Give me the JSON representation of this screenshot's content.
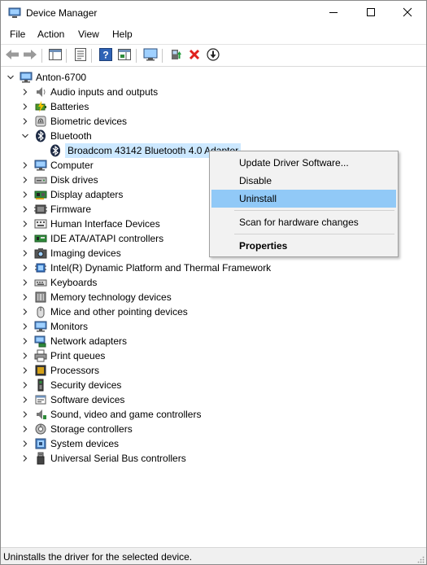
{
  "window": {
    "title": "Device Manager"
  },
  "menu": [
    "File",
    "Action",
    "View",
    "Help"
  ],
  "tree": {
    "root": "Anton-6700",
    "categories": [
      {
        "label": "Audio inputs and outputs",
        "icon": "speaker-icon"
      },
      {
        "label": "Batteries",
        "icon": "battery-icon"
      },
      {
        "label": "Biometric devices",
        "icon": "fingerprint-icon"
      },
      {
        "label": "Bluetooth",
        "icon": "bluetooth-icon",
        "expanded": true
      },
      {
        "label": "Computer",
        "icon": "computer-icon"
      },
      {
        "label": "Disk drives",
        "icon": "disk-drive-icon"
      },
      {
        "label": "Display adapters",
        "icon": "display-adapter-icon"
      },
      {
        "label": "Firmware",
        "icon": "firmware-icon"
      },
      {
        "label": "Human Interface Devices",
        "icon": "hid-icon"
      },
      {
        "label": "IDE ATA/ATAPI controllers",
        "icon": "ide-controller-icon"
      },
      {
        "label": "Imaging devices",
        "icon": "camera-icon"
      },
      {
        "label": "Intel(R) Dynamic Platform and Thermal Framework",
        "icon": "chip-icon"
      },
      {
        "label": "Keyboards",
        "icon": "keyboard-icon"
      },
      {
        "label": "Memory technology devices",
        "icon": "memory-icon"
      },
      {
        "label": "Mice and other pointing devices",
        "icon": "mouse-icon"
      },
      {
        "label": "Monitors",
        "icon": "monitor-icon"
      },
      {
        "label": "Network adapters",
        "icon": "network-adapter-icon"
      },
      {
        "label": "Print queues",
        "icon": "printer-icon"
      },
      {
        "label": "Processors",
        "icon": "processor-icon"
      },
      {
        "label": "Security devices",
        "icon": "security-device-icon"
      },
      {
        "label": "Software devices",
        "icon": "software-device-icon"
      },
      {
        "label": "Sound, video and game controllers",
        "icon": "sound-controller-icon"
      },
      {
        "label": "Storage controllers",
        "icon": "storage-controller-icon"
      },
      {
        "label": "System devices",
        "icon": "system-device-icon"
      },
      {
        "label": "Universal Serial Bus controllers",
        "icon": "usb-icon"
      }
    ],
    "bluetooth_child": "Broadcom 43142 Bluetooth 4.0 Adapter"
  },
  "context_menu": {
    "update": "Update Driver Software...",
    "disable": "Disable",
    "uninstall": "Uninstall",
    "scan": "Scan for hardware changes",
    "properties": "Properties"
  },
  "status": {
    "text": "Uninstalls the driver for the selected device."
  },
  "colors": {
    "selection": "#cce8ff",
    "menu_highlight": "#91c9f7",
    "accent_blue": "#1e6fc4",
    "delete_red": "#e0201c"
  }
}
